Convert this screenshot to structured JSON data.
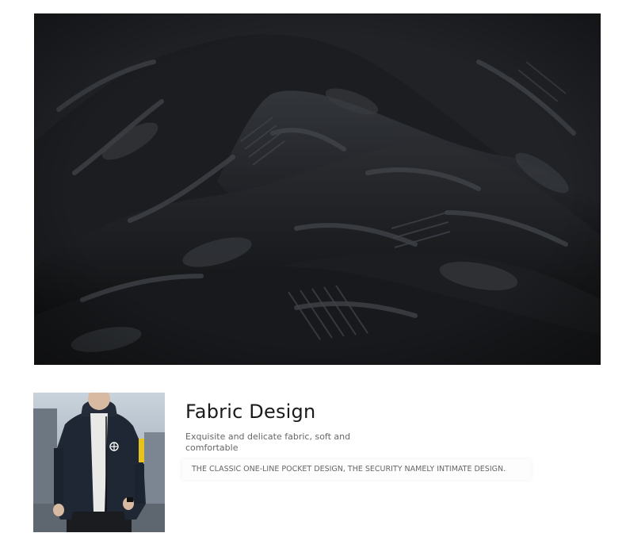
{
  "section": {
    "title": "Fabric Design",
    "description": "Exquisite and delicate fabric, soft and comfortable",
    "tagline": "THE CLASSIC ONE-LINE POCKET DESIGN, THE SECURITY NAMELY INTIMATE DESIGN."
  },
  "images": {
    "fabric_closeup": "fabric-closeup-photo",
    "model": "jacket-model-photo"
  },
  "colors": {
    "fabric_base": "#1b1c1e",
    "fabric_print": "#3a3d42",
    "jacket": "#1e2733",
    "pocket_zip_accent": "#e8c21c",
    "text_dark": "#1a1a1a",
    "text_muted": "#666666"
  }
}
